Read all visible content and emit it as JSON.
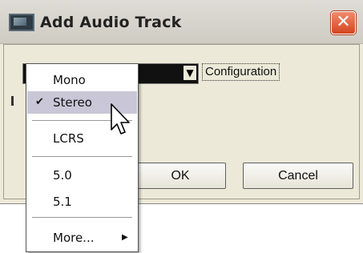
{
  "window": {
    "title": "Add Audio Track",
    "close_label": "✕"
  },
  "config": {
    "label": "Configuration"
  },
  "buttons": {
    "ok": "OK",
    "cancel": "Cancel"
  },
  "menu": {
    "items": [
      {
        "label": "Mono",
        "checked": false
      },
      {
        "label": "Stereo",
        "checked": true,
        "highlighted": true
      },
      {
        "label": "LCRS",
        "checked": false
      },
      {
        "label": "5.0",
        "checked": false
      },
      {
        "label": "5.1",
        "checked": false
      },
      {
        "label": "More...",
        "checked": false,
        "submenu": true
      }
    ],
    "check_glyph": "✔",
    "submenu_glyph": "▶"
  },
  "colors": {
    "highlight": "#c9c6d7",
    "close_button": "#d4451f"
  }
}
